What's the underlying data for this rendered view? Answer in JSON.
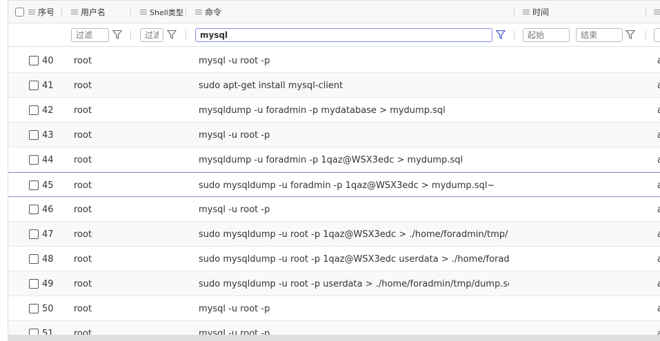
{
  "columns": [
    {
      "key": "seq",
      "label": "序号"
    },
    {
      "key": "user",
      "label": "用户名"
    },
    {
      "key": "shell",
      "label": "Shell类型"
    },
    {
      "key": "command",
      "label": "命令"
    },
    {
      "key": "time",
      "label": "时间"
    }
  ],
  "filters": {
    "user_placeholder": "过滤",
    "shell_placeholder": "过滤",
    "command_value": "mysql",
    "time_start_placeholder": "起始",
    "time_end_placeholder": "结束"
  },
  "rows": [
    {
      "seq": "40",
      "user": "root",
      "command": "mysql -u root -p",
      "extra": "a"
    },
    {
      "seq": "41",
      "user": "root",
      "command": "sudo apt-get install mysql-client",
      "extra": "a"
    },
    {
      "seq": "42",
      "user": "root",
      "command": "mysqldump -u foradmin -p mydatabase > mydump.sql",
      "extra": "a"
    },
    {
      "seq": "43",
      "user": "root",
      "command": "mysql -u root -p",
      "extra": "a"
    },
    {
      "seq": "44",
      "user": "root",
      "command": "mysqldump -u foradmin -p 1qaz@WSX3edc > mydump.sql",
      "extra": "a"
    },
    {
      "seq": "45",
      "user": "root",
      "command": "sudo mysqldump -u foradmin -p 1qaz@WSX3edc > mydump.sql~",
      "extra": "a"
    },
    {
      "seq": "46",
      "user": "root",
      "command": "mysql -u root -p",
      "extra": "a"
    },
    {
      "seq": "47",
      "user": "root",
      "command": "sudo mysqldump -u root -p 1qaz@WSX3edc > ./home/foradmin/tmp/...",
      "extra": "a"
    },
    {
      "seq": "48",
      "user": "root",
      "command": "sudo mysqldump -u root -p 1qaz@WSX3edc userdata > ./home/forad...",
      "extra": "a"
    },
    {
      "seq": "49",
      "user": "root",
      "command": "sudo mysqldump -u root -p userdata > ./home/foradmin/tmp/dump.sql",
      "extra": "a"
    },
    {
      "seq": "50",
      "user": "root",
      "command": "mysql -u root -p",
      "extra": "a"
    },
    {
      "seq": "51",
      "user": "root",
      "command": "mysql -u root -p",
      "extra": "a"
    }
  ],
  "selected_row_seq": "45",
  "colors": {
    "accent": "#7f8ce8",
    "row_alt": "#f8f9fb",
    "border": "#dfe2e6"
  }
}
